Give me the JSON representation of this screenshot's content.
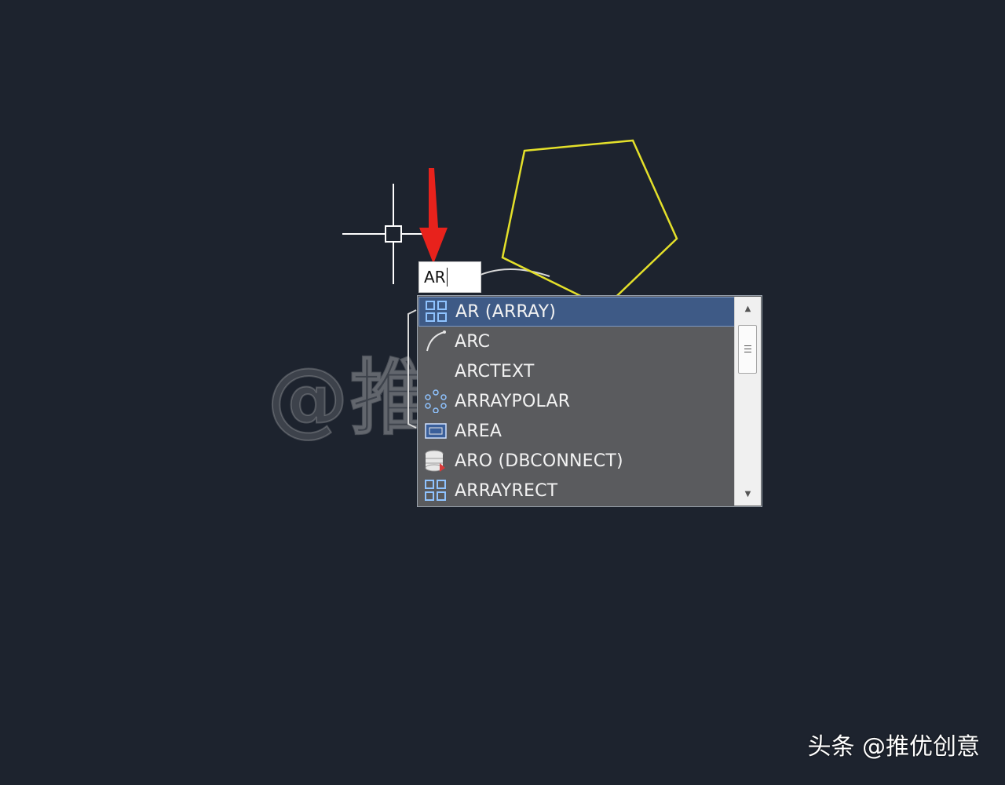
{
  "command_input": {
    "value": "AR"
  },
  "autocomplete": {
    "selected_index": 0,
    "items": [
      {
        "label": "AR (ARRAY)",
        "icon": "array-icon"
      },
      {
        "label": "ARC",
        "icon": "arc-icon"
      },
      {
        "label": "ARCTEXT",
        "icon": "none"
      },
      {
        "label": "ARRAYPOLAR",
        "icon": "polar-array-icon"
      },
      {
        "label": "AREA",
        "icon": "area-icon"
      },
      {
        "label": "ARO (DBCONNECT)",
        "icon": "database-icon"
      },
      {
        "label": "ARRAYRECT",
        "icon": "array-icon"
      }
    ],
    "scrollbar": {
      "up": "▲",
      "down": "▼"
    }
  },
  "watermark": "@推优创意",
  "credit": "头条 @推优创意",
  "colors": {
    "background": "#1d232e",
    "pentagon": "#e4e02a",
    "crosshair": "#ffffff",
    "arrow": "#e8221c",
    "selection": "#3e5a86",
    "list_bg": "#5a5b5e"
  }
}
